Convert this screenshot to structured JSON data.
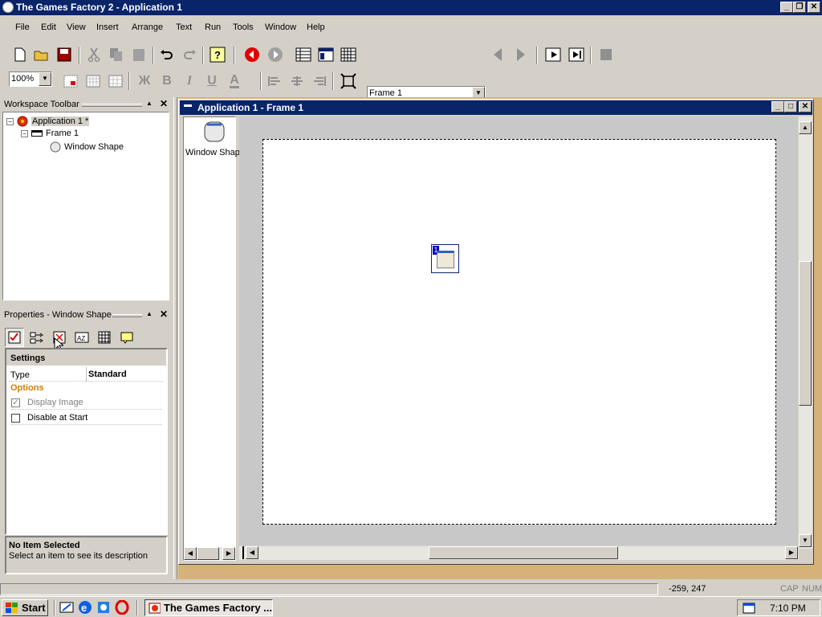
{
  "window": {
    "title": "The Games Factory 2 - Application 1"
  },
  "menu": [
    "File",
    "Edit",
    "View",
    "Insert",
    "Arrange",
    "Text",
    "Run",
    "Tools",
    "Window",
    "Help"
  ],
  "toolbar": {
    "frame_select": "Frame 1",
    "zoom_select": "100%"
  },
  "workspace": {
    "title": "Workspace Toolbar",
    "app_label": "Application 1 *",
    "frame_label": "Frame 1",
    "object_label": "Window Shape"
  },
  "properties": {
    "title": "Properties - Window Shape",
    "settings_header": "Settings",
    "type_label": "Type",
    "type_value": "Standard",
    "options_header": "Options",
    "display_image_label": "Display Image",
    "disable_at_start_label": "Disable at Start",
    "desc_title": "No Item Selected",
    "desc_text": "Select an item to see its description"
  },
  "editor": {
    "title": "Application 1 - Frame 1",
    "object_list_label": "Window Shap",
    "object_badge": "1"
  },
  "status": {
    "coords": "-259, 247",
    "cap": "CAP",
    "num": "NUM"
  },
  "taskbar": {
    "start_label": "Start",
    "task_label": "The Games Factory ...",
    "clock": "7:10 PM"
  }
}
